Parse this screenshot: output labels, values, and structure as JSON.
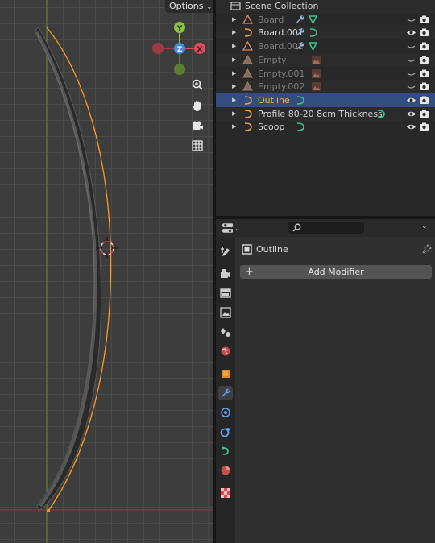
{
  "viewport": {
    "options_label": "Options",
    "options_caret": "⌄",
    "gizmo": {
      "x_label": "X",
      "y_label": "Y",
      "z_label": "Z"
    },
    "nav_icons": [
      "zoom-icon",
      "hand-icon",
      "camera-icon",
      "grid-icon"
    ]
  },
  "outliner": {
    "rows": [
      {
        "name": "Scene Collection",
        "state": "collection"
      },
      {
        "name": "Board",
        "state": "dim",
        "modifiers": [
          "wrench-icon",
          "vertex-group-icon"
        ]
      },
      {
        "name": "Board.001",
        "state": "normal",
        "modifiers": [
          "wrench-icon",
          "curve-icon"
        ]
      },
      {
        "name": "Board.002",
        "state": "dim",
        "modifiers": [
          "wrench-icon",
          "vertex-group-icon"
        ]
      },
      {
        "name": "Empty",
        "state": "dim",
        "modifiers": [
          "empty-image-icon"
        ]
      },
      {
        "name": "Empty.001",
        "state": "dim",
        "modifiers": [
          "empty-image-icon"
        ]
      },
      {
        "name": "Empty.002",
        "state": "dim",
        "modifiers": [
          "empty-image-icon"
        ]
      },
      {
        "name": "Outline",
        "state": "selected",
        "modifiers": [
          "curve-icon"
        ]
      },
      {
        "name": "Profile 80-20 8cm Thickness",
        "state": "normal",
        "modifiers": [
          "curve-icon"
        ]
      },
      {
        "name": "Scoop",
        "state": "normal",
        "modifiers": [
          "curve-icon"
        ]
      }
    ]
  },
  "properties": {
    "object_name": "Outline",
    "add_modifier_label": "Add Modifier",
    "add_modifier_plus": "+",
    "active_tab": "modifiers-tab"
  },
  "colors": {
    "selection_blue": "#334d80",
    "selected_orange": "#ffaf29",
    "axis_x_red": "#e24b5b",
    "axis_y_green": "#8ac43f",
    "axis_z_blue": "#3d8ee5"
  }
}
